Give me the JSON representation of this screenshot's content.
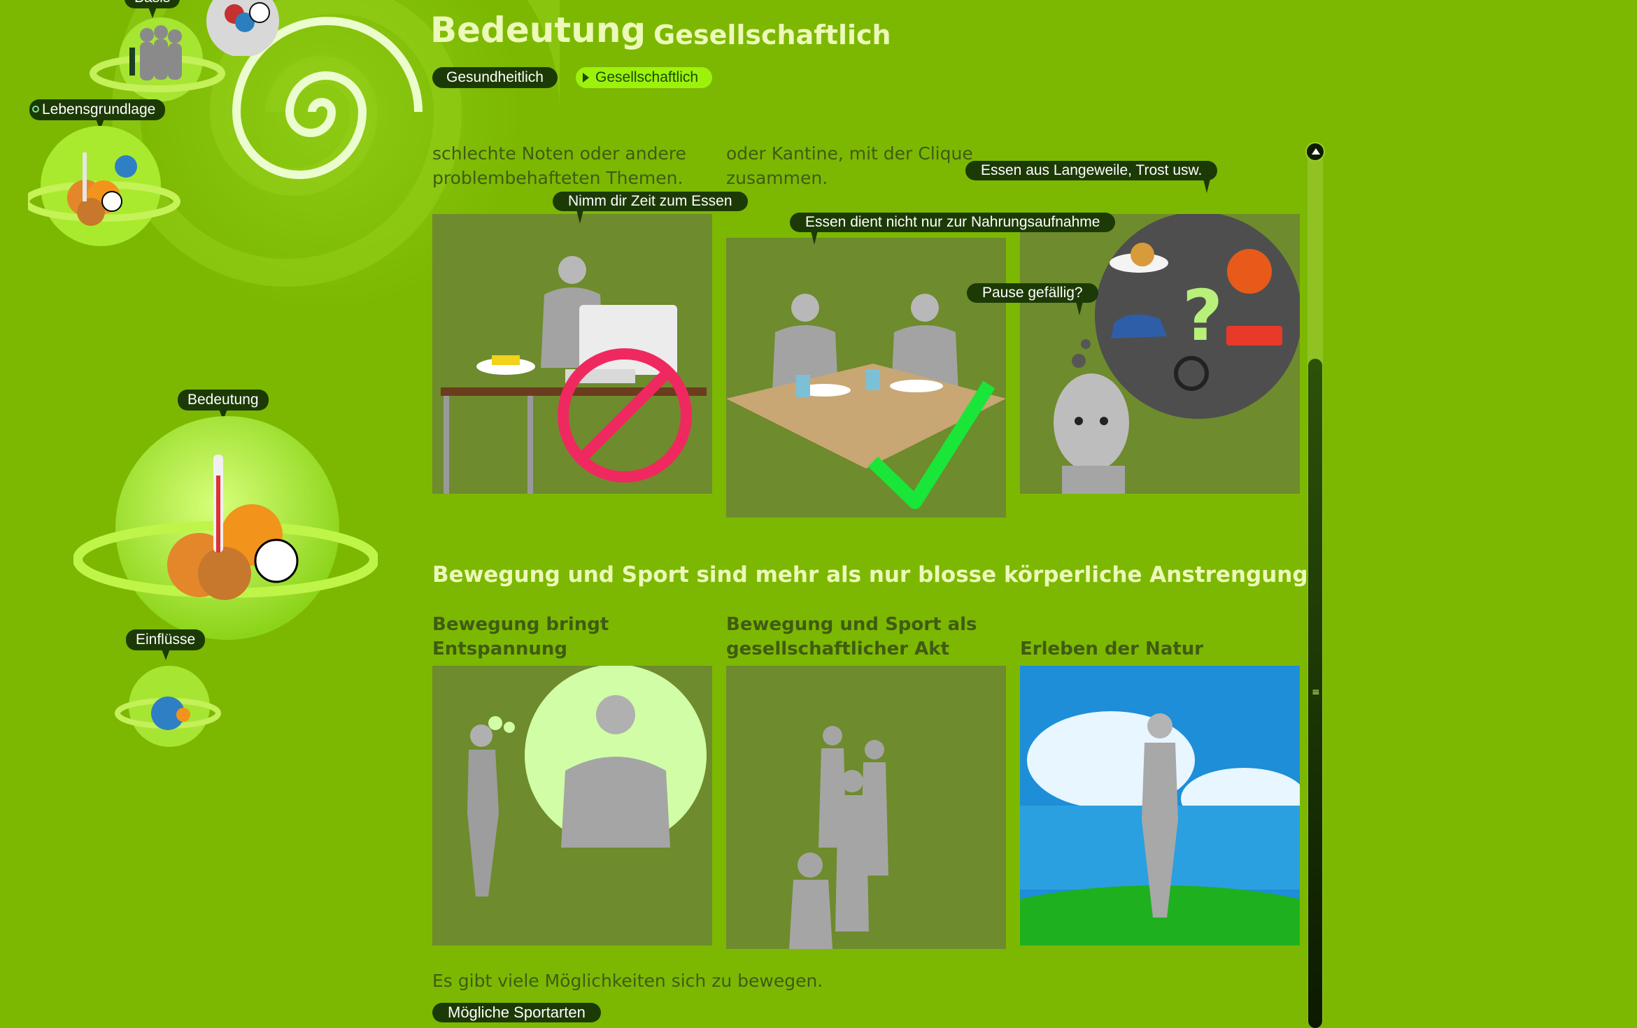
{
  "nav": {
    "items": [
      {
        "label": "Basis"
      },
      {
        "label": "Lebensgrundlage"
      },
      {
        "label": "Bedeutung"
      },
      {
        "label": "Einflüsse"
      }
    ]
  },
  "header": {
    "title": "Bedeutung",
    "subtitle": "Gesellschaftlich"
  },
  "tabs": [
    {
      "label": "Gesundheitlich",
      "active": false
    },
    {
      "label": "Gesellschaftlich",
      "active": true
    }
  ],
  "intro": {
    "col1": "schlechte Noten oder andere problembehafteten Themen.",
    "col2": "oder Kantine, mit der Clique zusammen."
  },
  "speech": {
    "essen_zeit": "Nimm dir Zeit zum Essen",
    "essen_nahrung": "Essen dient nicht nur zur Nahrungsaufnahme",
    "langeweile": "Essen aus Langeweile, Trost usw.",
    "pause": "Pause gefällig?"
  },
  "sport": {
    "heading": "Bewegung und Sport sind mehr als nur blosse körperliche Anstrengung",
    "items": [
      {
        "title": "Bewegung bringt Entspannung"
      },
      {
        "title": "Bewegung und Sport als gesellschaftlicher Akt"
      },
      {
        "title": "Erleben der Natur"
      }
    ],
    "footer": "Es gibt viele Möglichkeiten sich zu bewegen.",
    "button": "Mögliche Sportarten"
  },
  "colors": {
    "background": "#7cb802",
    "bubble": "#1c3a05",
    "heading": "#ecf9b8",
    "active_tab": "#9df20c",
    "panel": "#6e8b2d"
  },
  "icons": [
    "swirl-decoration",
    "planet-icon",
    "person-figure",
    "no-sign-icon",
    "checkmark-icon",
    "question-mark-icon",
    "scroll-up-icon"
  ]
}
